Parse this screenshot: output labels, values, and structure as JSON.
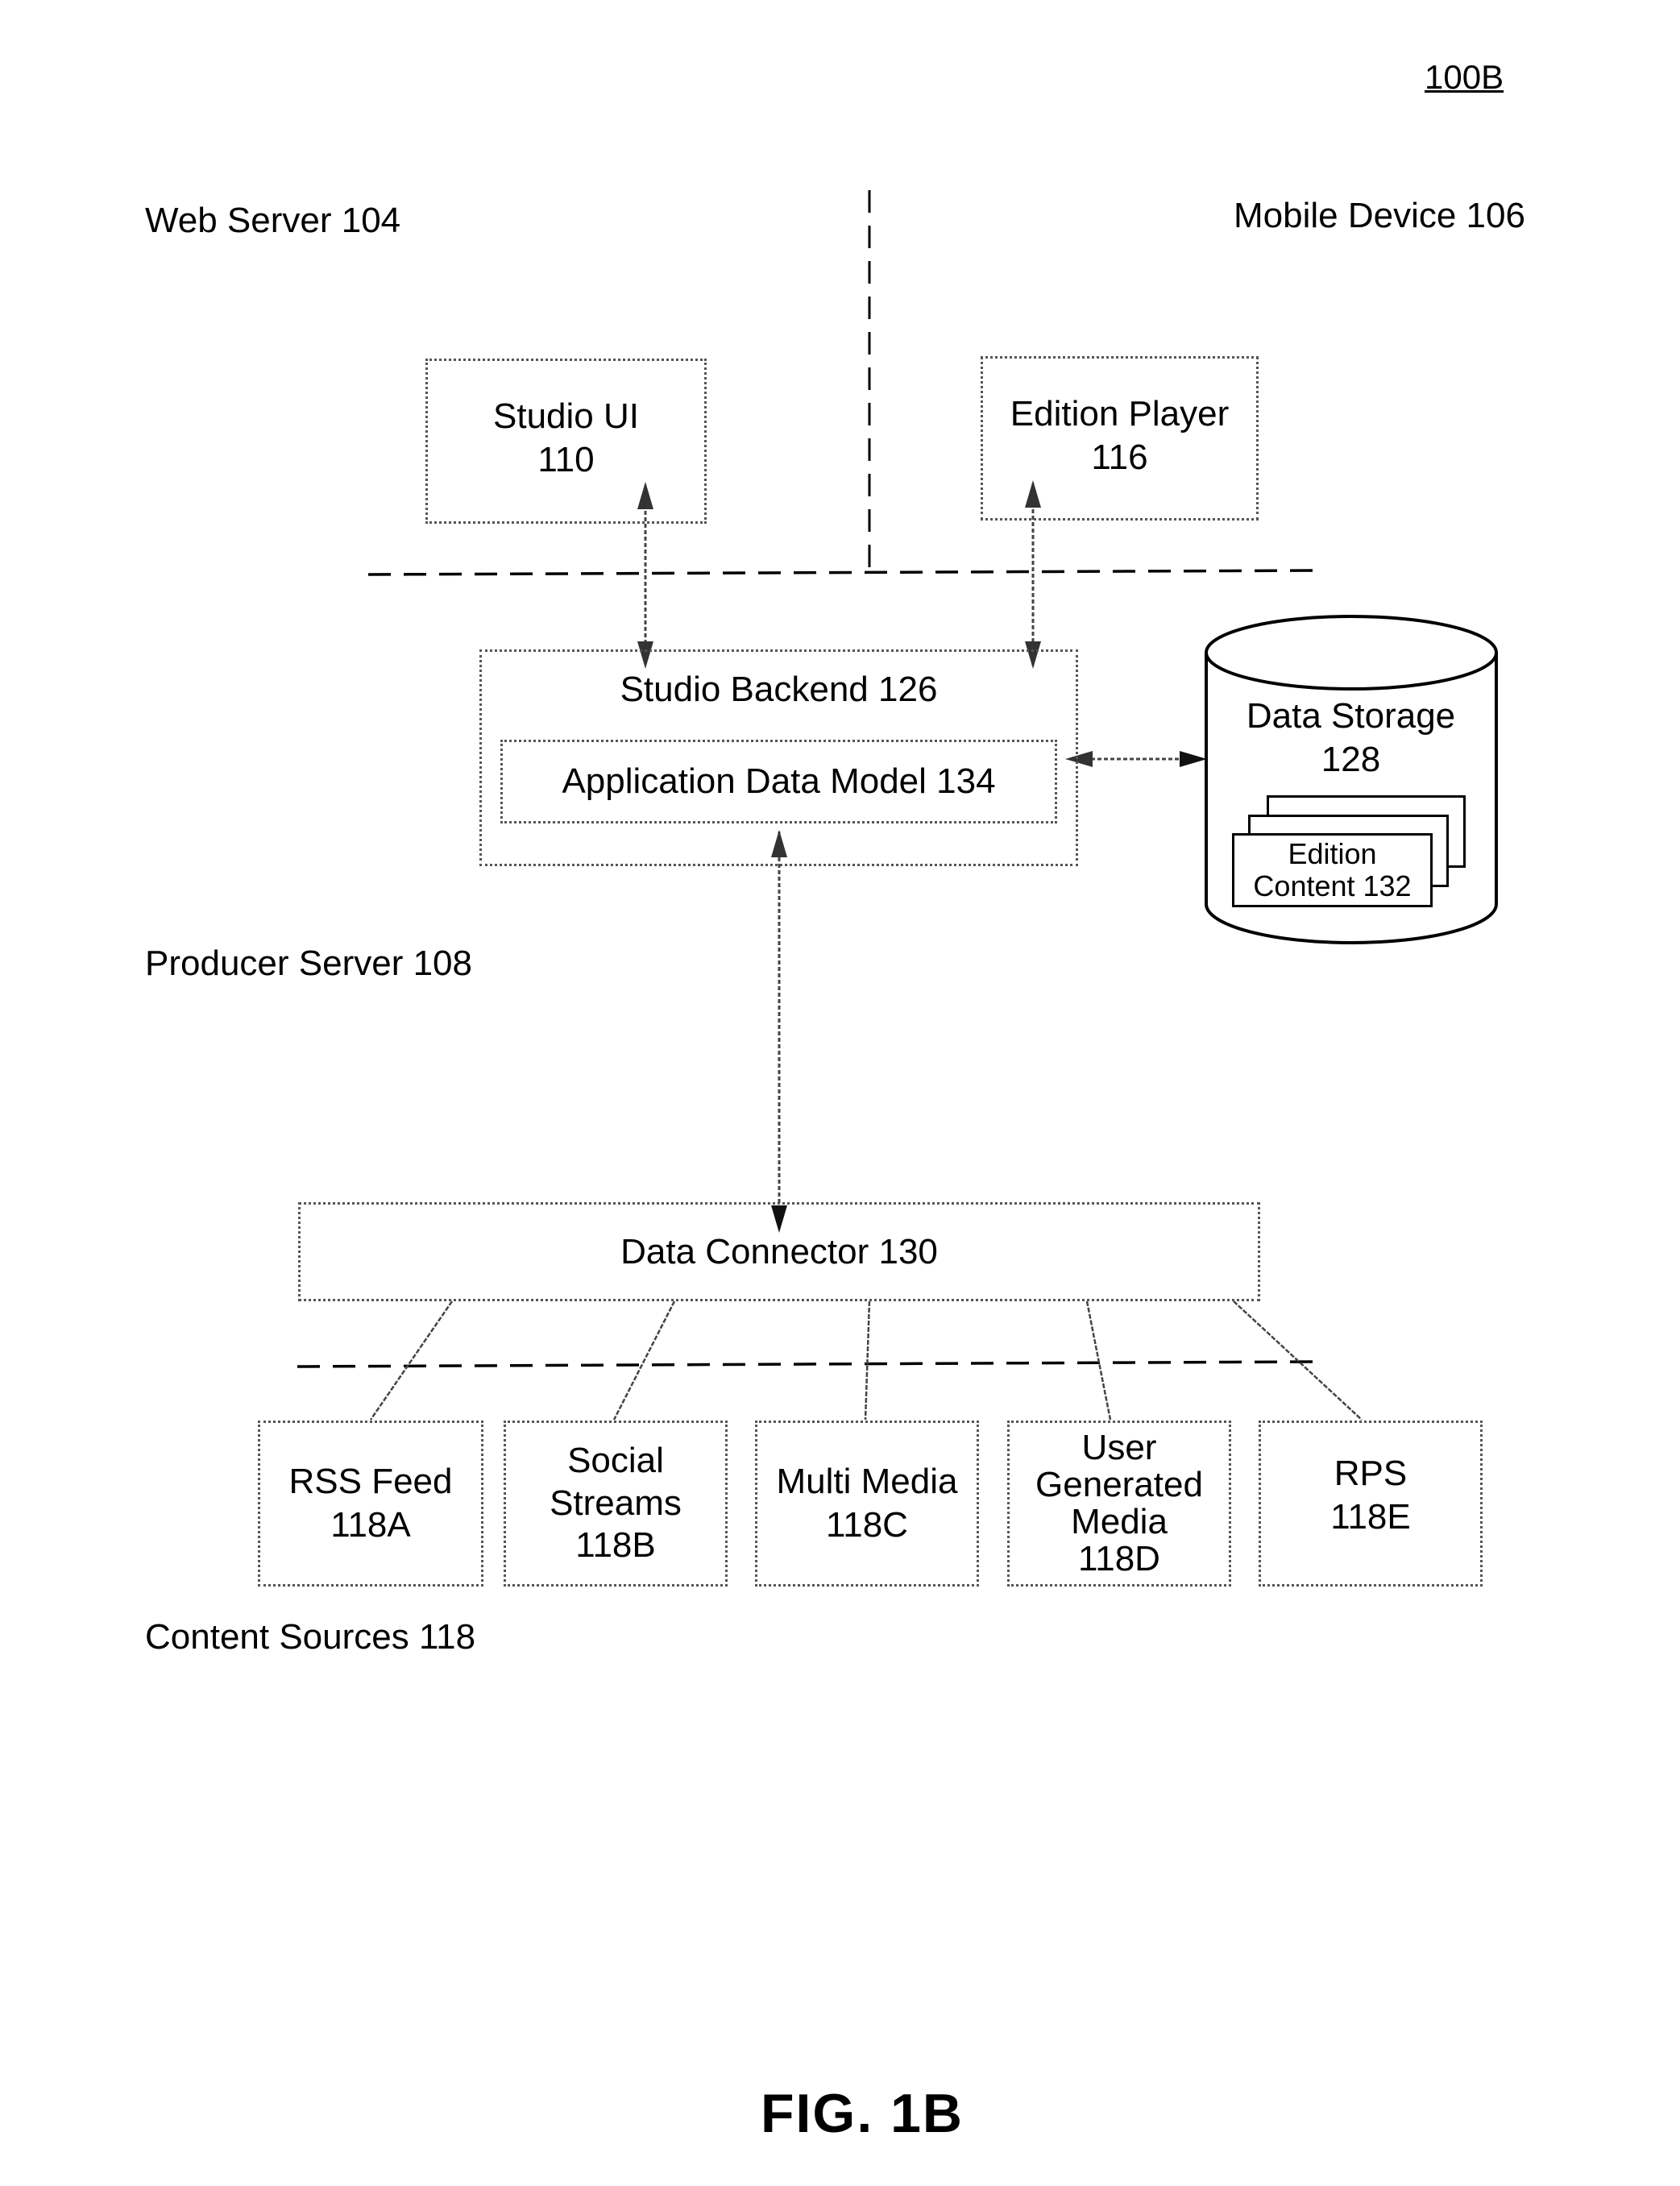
{
  "figure": {
    "reference": "100B",
    "caption": "FIG. 1B"
  },
  "regions": {
    "web_server": "Web Server 104",
    "mobile_device": "Mobile Device 106",
    "producer_server": "Producer Server 108",
    "content_sources": "Content Sources 118"
  },
  "components": {
    "studio_ui": {
      "name": "Studio UI",
      "ref": "110"
    },
    "edition_player": {
      "name": "Edition Player",
      "ref": "116"
    },
    "studio_backend": {
      "label": "Studio Backend 126"
    },
    "application_data_model": {
      "label": "Application Data Model 134"
    },
    "data_storage": {
      "name": "Data Storage",
      "ref": "128"
    },
    "edition_content": {
      "line1": "Edition",
      "line2": "Content 132"
    },
    "data_connector": {
      "label": "Data Connector 130"
    }
  },
  "sources": [
    {
      "lines": [
        "RSS Feed",
        "118A"
      ]
    },
    {
      "lines": [
        "Social",
        "Streams",
        "118B"
      ]
    },
    {
      "lines": [
        "Multi Media",
        "118C"
      ]
    },
    {
      "lines": [
        "User",
        "Generated",
        "Media",
        "118D"
      ]
    },
    {
      "lines": [
        "RPS",
        "118E"
      ]
    }
  ]
}
